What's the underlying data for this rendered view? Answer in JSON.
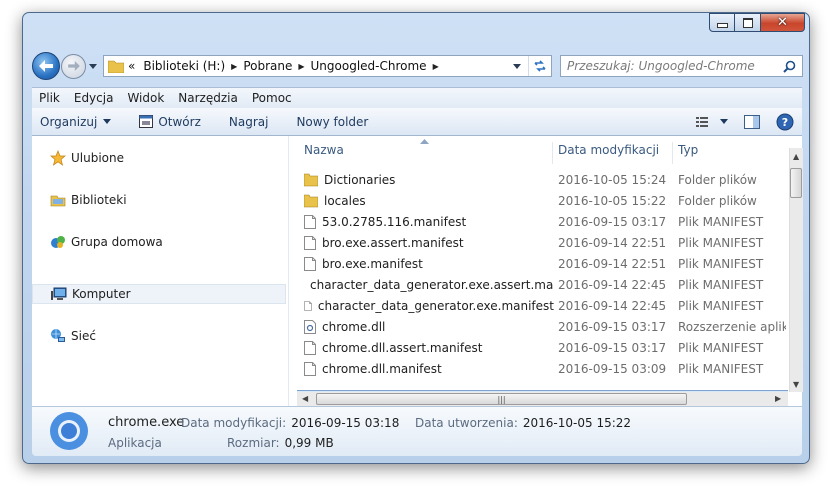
{
  "window": {
    "caption": {
      "minimize": "—",
      "maximize": "□",
      "close": "✕"
    }
  },
  "address": {
    "overflow": "«",
    "segments": [
      "Biblioteki (H:)",
      "Pobrane",
      "Ungoogled-Chrome"
    ]
  },
  "search": {
    "placeholder": "Przeszukaj: Ungoogled-Chrome"
  },
  "menu": [
    "Plik",
    "Edycja",
    "Widok",
    "Narzędzia",
    "Pomoc"
  ],
  "toolbar": {
    "organize": "Organizuj",
    "open": "Otwórz",
    "burn": "Nagraj",
    "new_folder": "Nowy folder"
  },
  "nav": {
    "items": [
      {
        "label": "Ulubione",
        "icon": "star-icon"
      },
      {
        "label": "Biblioteki",
        "icon": "libraries-icon"
      },
      {
        "label": "Grupa domowa",
        "icon": "homegroup-icon"
      },
      {
        "label": "Komputer",
        "icon": "computer-icon"
      },
      {
        "label": "Sieć",
        "icon": "network-icon"
      }
    ]
  },
  "columns": {
    "name": "Nazwa",
    "date": "Data modyfikacji",
    "type": "Typ"
  },
  "files": [
    {
      "name": "Dictionaries",
      "date": "2016-10-05 15:24",
      "type": "Folder plików",
      "icon": "folder"
    },
    {
      "name": "locales",
      "date": "2016-10-05 15:22",
      "type": "Folder plików",
      "icon": "folder"
    },
    {
      "name": "53.0.2785.116.manifest",
      "date": "2016-09-15 03:17",
      "type": "Plik MANIFEST",
      "icon": "file"
    },
    {
      "name": "bro.exe.assert.manifest",
      "date": "2016-09-14 22:51",
      "type": "Plik MANIFEST",
      "icon": "file"
    },
    {
      "name": "bro.exe.manifest",
      "date": "2016-09-14 22:51",
      "type": "Plik MANIFEST",
      "icon": "file"
    },
    {
      "name": "character_data_generator.exe.assert.mani...",
      "date": "2016-09-14 22:45",
      "type": "Plik MANIFEST",
      "icon": "file"
    },
    {
      "name": "character_data_generator.exe.manifest",
      "date": "2016-09-14 22:45",
      "type": "Plik MANIFEST",
      "icon": "file"
    },
    {
      "name": "chrome.dll",
      "date": "2016-09-15 03:17",
      "type": "Rozszerzenie aplik.",
      "icon": "dll"
    },
    {
      "name": "chrome.dll.assert.manifest",
      "date": "2016-09-15 03:17",
      "type": "Plik MANIFEST",
      "icon": "file"
    },
    {
      "name": "chrome.dll.manifest",
      "date": "2016-09-15 03:09",
      "type": "Plik MANIFEST",
      "icon": "file"
    }
  ],
  "details": {
    "name": "chrome.exe",
    "kind": "Aplikacja",
    "modified_label": "Data modyfikacji:",
    "modified_value": "2016-09-15 03:18",
    "size_label": "Rozmiar:",
    "size_value": "0,99 MB",
    "created_label": "Data utworzenia:",
    "created_value": "2016-10-05 15:22"
  },
  "colors": {
    "folder": "#e8c24a",
    "accent": "#1c4377",
    "selection": "#d7e8f9"
  }
}
